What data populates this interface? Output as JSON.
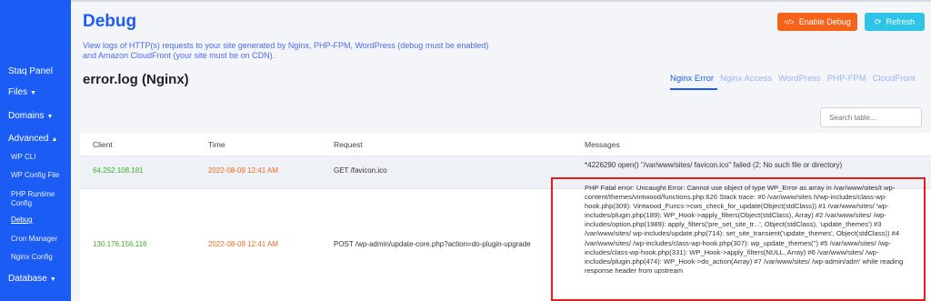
{
  "sidebar": {
    "items": [
      {
        "label": "Staq Panel"
      },
      {
        "label": "Files",
        "caret": "▼"
      },
      {
        "label": "Domains",
        "caret": "▼"
      },
      {
        "label": "Advanced",
        "caret": "▲"
      }
    ],
    "advanced_sub": [
      "WP CLI",
      "WP Config File",
      "PHP Runtime Config",
      "Debug",
      "Cron Manager",
      "Nginx Config"
    ],
    "database": {
      "label": "Database",
      "caret": "▼"
    }
  },
  "header": {
    "title": "Debug",
    "description": "View logs of HTTP(s) requests to your site generated by Nginx, PHP-FPM, WordPress (debug must be enabled) and Amazon CloudFront (your site must be on CDN).",
    "enable_debug_label": "Enable Debug",
    "enable_debug_icon": "</>",
    "refresh_label": "Refresh",
    "refresh_icon": "⟳"
  },
  "log": {
    "title": "error.log (Nginx)",
    "tabs": [
      "Nginx Error",
      "Nginx Access",
      "WordPress",
      "PHP-FPM",
      "CloudFront"
    ],
    "active_tab": "Nginx Error",
    "search_placeholder": "Search table..."
  },
  "table": {
    "columns": [
      "Client",
      "Time",
      "Request",
      "Messages"
    ],
    "rows": [
      {
        "client": "64.252.108.181",
        "time": "2022-08-09 12:41 AM",
        "request": "GET /favicon.ico",
        "message": "*4226290 open() \"/var/www/sites/                              favicon.ico\" failed (2: No such file or directory)"
      },
      {
        "client": "130.176.156.116",
        "time": "2022-08-09 12:41 AM",
        "request": "POST /wp-admin/update-core.php?action=do-plugin-upgrade",
        "message": "PHP Fatal error: Uncaught Error: Cannot use object of type WP_Error as array in /var/www/sites/t                    wp-content/themes/vintwood/functions.php:626 Stack trace: #0 /var/www/sites                    h/wp-includes/class-wp-hook.php(309): Vintwood_Funcs->cws_check_for_update(Object(stdClass)) #1 /var/www/sites/                  'wp-includes/plugin.php(189): WP_Hook->apply_filters(Object(stdClass), Array) #2 /var/www/sites/                /wp-includes/option.php(1989): apply_filters('pre_set_site_tr...', Object(stdClass), 'update_themes') #3 /var/www/sites/                  wp-includes/update.php(714): set_site_transient('update_themes', Object(stdClass)) #4 /var/www/sites/                /wp-includes/class-wp-hook.php(307): wp_update_themes('') #5 /var/www/sites/                 /wp-includes/class-wp-hook.php(331): WP_Hook->apply_filters(NULL, Array) #6 /var/www/sites/                /wp-includes/plugin.php(474): WP_Hook->do_action(Array) #7 /var/www/sites/                    /wp-admin/adm' while reading response header from upstream"
      }
    ]
  },
  "colors": {
    "sidebar": "#1b5cf5",
    "accent": "#1b5cf5",
    "enable_button": "#f5631a",
    "refresh_button": "#2ec4e8",
    "ip_green": "#3fae2a",
    "time_orange": "#f06a1f",
    "highlight_red": "#e81c1c"
  }
}
